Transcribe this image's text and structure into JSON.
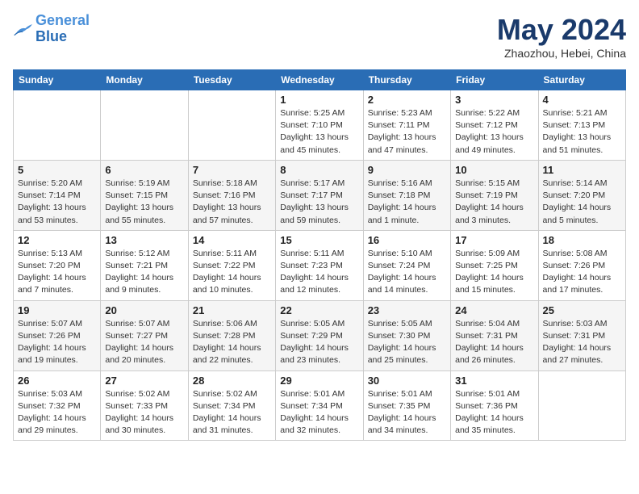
{
  "header": {
    "logo_line1": "General",
    "logo_line2": "Blue",
    "month": "May 2024",
    "location": "Zhaozhou, Hebei, China"
  },
  "weekdays": [
    "Sunday",
    "Monday",
    "Tuesday",
    "Wednesday",
    "Thursday",
    "Friday",
    "Saturday"
  ],
  "weeks": [
    [
      {
        "day": "",
        "sunrise": "",
        "sunset": "",
        "daylight": ""
      },
      {
        "day": "",
        "sunrise": "",
        "sunset": "",
        "daylight": ""
      },
      {
        "day": "",
        "sunrise": "",
        "sunset": "",
        "daylight": ""
      },
      {
        "day": "1",
        "sunrise": "Sunrise: 5:25 AM",
        "sunset": "Sunset: 7:10 PM",
        "daylight": "Daylight: 13 hours and 45 minutes."
      },
      {
        "day": "2",
        "sunrise": "Sunrise: 5:23 AM",
        "sunset": "Sunset: 7:11 PM",
        "daylight": "Daylight: 13 hours and 47 minutes."
      },
      {
        "day": "3",
        "sunrise": "Sunrise: 5:22 AM",
        "sunset": "Sunset: 7:12 PM",
        "daylight": "Daylight: 13 hours and 49 minutes."
      },
      {
        "day": "4",
        "sunrise": "Sunrise: 5:21 AM",
        "sunset": "Sunset: 7:13 PM",
        "daylight": "Daylight: 13 hours and 51 minutes."
      }
    ],
    [
      {
        "day": "5",
        "sunrise": "Sunrise: 5:20 AM",
        "sunset": "Sunset: 7:14 PM",
        "daylight": "Daylight: 13 hours and 53 minutes."
      },
      {
        "day": "6",
        "sunrise": "Sunrise: 5:19 AM",
        "sunset": "Sunset: 7:15 PM",
        "daylight": "Daylight: 13 hours and 55 minutes."
      },
      {
        "day": "7",
        "sunrise": "Sunrise: 5:18 AM",
        "sunset": "Sunset: 7:16 PM",
        "daylight": "Daylight: 13 hours and 57 minutes."
      },
      {
        "day": "8",
        "sunrise": "Sunrise: 5:17 AM",
        "sunset": "Sunset: 7:17 PM",
        "daylight": "Daylight: 13 hours and 59 minutes."
      },
      {
        "day": "9",
        "sunrise": "Sunrise: 5:16 AM",
        "sunset": "Sunset: 7:18 PM",
        "daylight": "Daylight: 14 hours and 1 minute."
      },
      {
        "day": "10",
        "sunrise": "Sunrise: 5:15 AM",
        "sunset": "Sunset: 7:19 PM",
        "daylight": "Daylight: 14 hours and 3 minutes."
      },
      {
        "day": "11",
        "sunrise": "Sunrise: 5:14 AM",
        "sunset": "Sunset: 7:20 PM",
        "daylight": "Daylight: 14 hours and 5 minutes."
      }
    ],
    [
      {
        "day": "12",
        "sunrise": "Sunrise: 5:13 AM",
        "sunset": "Sunset: 7:20 PM",
        "daylight": "Daylight: 14 hours and 7 minutes."
      },
      {
        "day": "13",
        "sunrise": "Sunrise: 5:12 AM",
        "sunset": "Sunset: 7:21 PM",
        "daylight": "Daylight: 14 hours and 9 minutes."
      },
      {
        "day": "14",
        "sunrise": "Sunrise: 5:11 AM",
        "sunset": "Sunset: 7:22 PM",
        "daylight": "Daylight: 14 hours and 10 minutes."
      },
      {
        "day": "15",
        "sunrise": "Sunrise: 5:11 AM",
        "sunset": "Sunset: 7:23 PM",
        "daylight": "Daylight: 14 hours and 12 minutes."
      },
      {
        "day": "16",
        "sunrise": "Sunrise: 5:10 AM",
        "sunset": "Sunset: 7:24 PM",
        "daylight": "Daylight: 14 hours and 14 minutes."
      },
      {
        "day": "17",
        "sunrise": "Sunrise: 5:09 AM",
        "sunset": "Sunset: 7:25 PM",
        "daylight": "Daylight: 14 hours and 15 minutes."
      },
      {
        "day": "18",
        "sunrise": "Sunrise: 5:08 AM",
        "sunset": "Sunset: 7:26 PM",
        "daylight": "Daylight: 14 hours and 17 minutes."
      }
    ],
    [
      {
        "day": "19",
        "sunrise": "Sunrise: 5:07 AM",
        "sunset": "Sunset: 7:26 PM",
        "daylight": "Daylight: 14 hours and 19 minutes."
      },
      {
        "day": "20",
        "sunrise": "Sunrise: 5:07 AM",
        "sunset": "Sunset: 7:27 PM",
        "daylight": "Daylight: 14 hours and 20 minutes."
      },
      {
        "day": "21",
        "sunrise": "Sunrise: 5:06 AM",
        "sunset": "Sunset: 7:28 PM",
        "daylight": "Daylight: 14 hours and 22 minutes."
      },
      {
        "day": "22",
        "sunrise": "Sunrise: 5:05 AM",
        "sunset": "Sunset: 7:29 PM",
        "daylight": "Daylight: 14 hours and 23 minutes."
      },
      {
        "day": "23",
        "sunrise": "Sunrise: 5:05 AM",
        "sunset": "Sunset: 7:30 PM",
        "daylight": "Daylight: 14 hours and 25 minutes."
      },
      {
        "day": "24",
        "sunrise": "Sunrise: 5:04 AM",
        "sunset": "Sunset: 7:31 PM",
        "daylight": "Daylight: 14 hours and 26 minutes."
      },
      {
        "day": "25",
        "sunrise": "Sunrise: 5:03 AM",
        "sunset": "Sunset: 7:31 PM",
        "daylight": "Daylight: 14 hours and 27 minutes."
      }
    ],
    [
      {
        "day": "26",
        "sunrise": "Sunrise: 5:03 AM",
        "sunset": "Sunset: 7:32 PM",
        "daylight": "Daylight: 14 hours and 29 minutes."
      },
      {
        "day": "27",
        "sunrise": "Sunrise: 5:02 AM",
        "sunset": "Sunset: 7:33 PM",
        "daylight": "Daylight: 14 hours and 30 minutes."
      },
      {
        "day": "28",
        "sunrise": "Sunrise: 5:02 AM",
        "sunset": "Sunset: 7:34 PM",
        "daylight": "Daylight: 14 hours and 31 minutes."
      },
      {
        "day": "29",
        "sunrise": "Sunrise: 5:01 AM",
        "sunset": "Sunset: 7:34 PM",
        "daylight": "Daylight: 14 hours and 32 minutes."
      },
      {
        "day": "30",
        "sunrise": "Sunrise: 5:01 AM",
        "sunset": "Sunset: 7:35 PM",
        "daylight": "Daylight: 14 hours and 34 minutes."
      },
      {
        "day": "31",
        "sunrise": "Sunrise: 5:01 AM",
        "sunset": "Sunset: 7:36 PM",
        "daylight": "Daylight: 14 hours and 35 minutes."
      },
      {
        "day": "",
        "sunrise": "",
        "sunset": "",
        "daylight": ""
      }
    ]
  ]
}
